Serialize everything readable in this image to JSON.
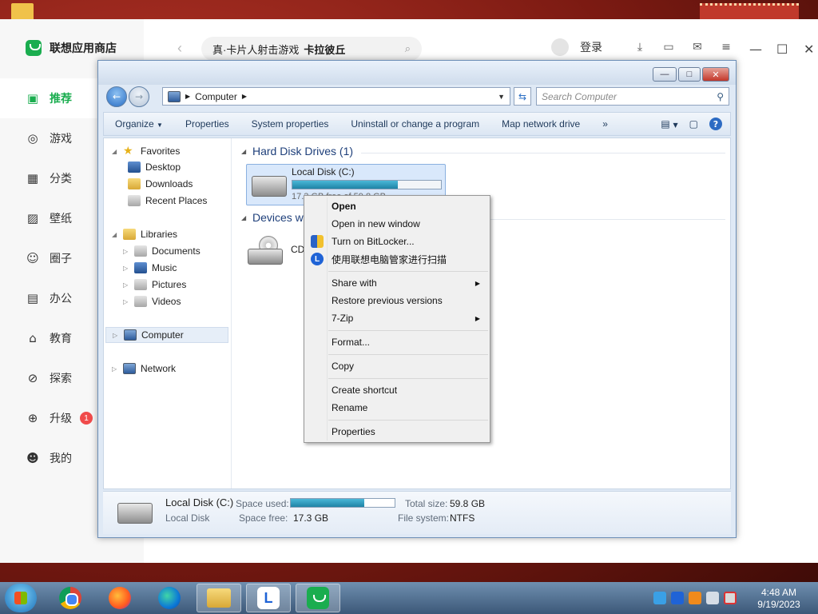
{
  "app_store": {
    "title": "联想应用商店",
    "search_text": "真·卡片人射击游戏",
    "search_highlight": "卡拉彼丘",
    "login": "登录",
    "nav": [
      {
        "label": "推荐",
        "icon": "recommend-icon",
        "active": true
      },
      {
        "label": "游戏",
        "icon": "gamepad-icon"
      },
      {
        "label": "分类",
        "icon": "category-icon"
      },
      {
        "label": "壁纸",
        "icon": "wallpaper-icon"
      },
      {
        "label": "圈子",
        "icon": "community-icon"
      },
      {
        "label": "办公",
        "icon": "briefcase-icon"
      },
      {
        "label": "教育",
        "icon": "graduation-icon"
      },
      {
        "label": "探索",
        "icon": "explore-icon"
      },
      {
        "label": "升级",
        "icon": "upgrade-icon",
        "badge": "1"
      },
      {
        "label": "我的",
        "icon": "profile-icon"
      }
    ]
  },
  "explorer": {
    "address": "Computer",
    "search_placeholder": "Search Computer",
    "commands": [
      "Organize",
      "Properties",
      "System properties",
      "Uninstall or change a program",
      "Map network drive"
    ],
    "more": "»",
    "nav_pane": {
      "favorites": "Favorites",
      "desktop": "Desktop",
      "downloads": "Downloads",
      "recent": "Recent Places",
      "libraries": "Libraries",
      "documents": "Documents",
      "music": "Music",
      "pictures": "Pictures",
      "videos": "Videos",
      "computer": "Computer",
      "network": "Network"
    },
    "group_hdd": "Hard Disk Drives (1)",
    "group_devices": "Devices wi",
    "drive_name": "Local Disk (C:)",
    "drive_free": "17.3 GB free of 59.8 GB",
    "drive_used_fraction": 0.71,
    "cd_label": "CD",
    "details": {
      "name": "Local Disk (C:)",
      "type": "Local Disk",
      "space_used_label": "Space used:",
      "space_free_label": "Space free:",
      "space_free": "17.3 GB",
      "total_size_label": "Total size:",
      "total_size": "59.8 GB",
      "file_system_label": "File system:",
      "file_system": "NTFS"
    }
  },
  "context_menu": {
    "open": "Open",
    "open_new_window": "Open in new window",
    "bitlocker": "Turn on BitLocker...",
    "lenovo_scan": "使用联想电脑管家进行扫描",
    "share_with": "Share with",
    "restore": "Restore previous versions",
    "zip": "7-Zip",
    "format": "Format...",
    "copy": "Copy",
    "create_shortcut": "Create shortcut",
    "rename": "Rename",
    "properties": "Properties"
  },
  "taskbar": {
    "time": "4:48 AM",
    "date": "9/19/2023"
  },
  "colors": {
    "accent_green": "#1aad4f",
    "explorer_blue": "#1e3f7a",
    "bar_fill": "#1f83a6"
  }
}
